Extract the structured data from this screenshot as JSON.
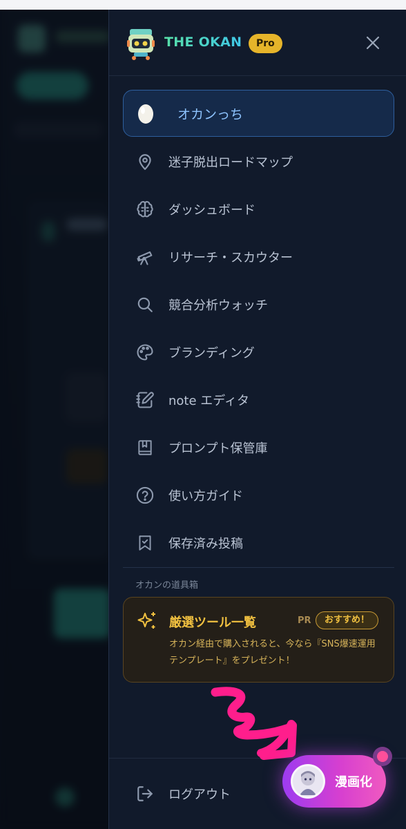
{
  "app": {
    "brand": "THE OKAN",
    "plan_badge": "Pro"
  },
  "nav": {
    "items": [
      {
        "label": "オカンっち",
        "icon": "egg-icon",
        "active": true
      },
      {
        "label": "迷子脱出ロードマップ",
        "icon": "map-pin-icon"
      },
      {
        "label": "ダッシュボード",
        "icon": "brain-icon"
      },
      {
        "label": "リサーチ・スカウター",
        "icon": "telescope-icon"
      },
      {
        "label": "競合分析ウォッチ",
        "icon": "search-icon"
      },
      {
        "label": "ブランディング",
        "icon": "palette-icon"
      },
      {
        "label": "note エディタ",
        "icon": "notebook-pen-icon"
      },
      {
        "label": "プロンプト保管庫",
        "icon": "book-bookmark-icon"
      },
      {
        "label": "使い方ガイド",
        "icon": "help-circle-icon"
      },
      {
        "label": "保存済み投稿",
        "icon": "bookmark-check-icon"
      }
    ]
  },
  "toolbox": {
    "section_label": "オカンの道具箱",
    "promo_title": "厳選ツール一覧",
    "pr_tag": "PR",
    "badge": "おすすめ！",
    "description": "オカン経由で購入されると、今なら『SNS爆速運用テンプレート』をプレゼント！",
    "icon": "sparkles-icon"
  },
  "footer": {
    "logout_label": "ログアウト",
    "logout_icon": "logout-icon"
  },
  "floating": {
    "manga_label": "漫画化",
    "avatar_icon": "character-avatar-icon"
  },
  "colors": {
    "drawer_bg": "#111a2b",
    "active_bg": "#152a4a",
    "active_text": "#8ec4ff",
    "pro_badge": "#e6b42a",
    "promo_accent": "#f0c040",
    "manga_gradient_start": "#9c3cf0",
    "manga_gradient_end": "#f05ac0",
    "annotation_arrow": "#ff1e8c"
  }
}
